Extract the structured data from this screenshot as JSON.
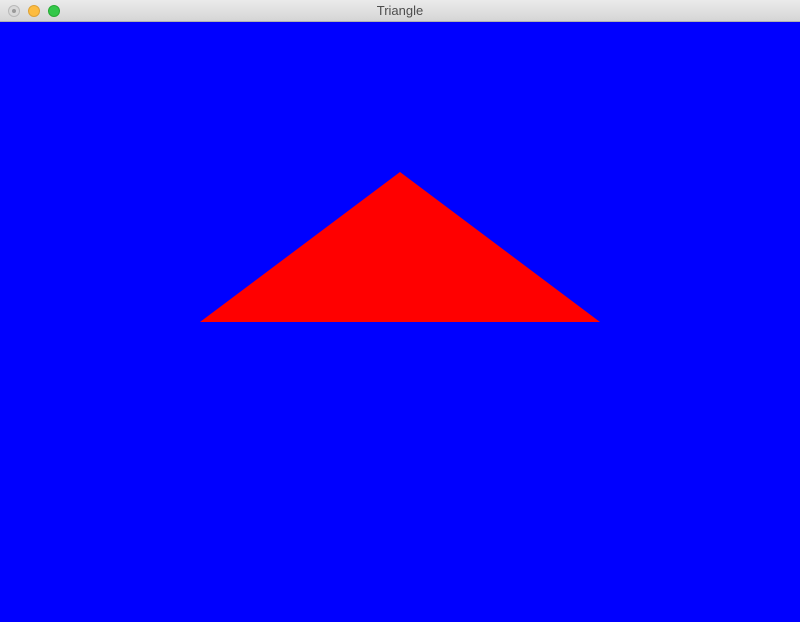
{
  "window": {
    "title": "Triangle"
  },
  "scene": {
    "background_color": "#0000ff",
    "triangle_color": "#ff0000"
  },
  "icons": {
    "close": "close-icon",
    "minimize": "minimize-icon",
    "zoom": "zoom-icon"
  }
}
